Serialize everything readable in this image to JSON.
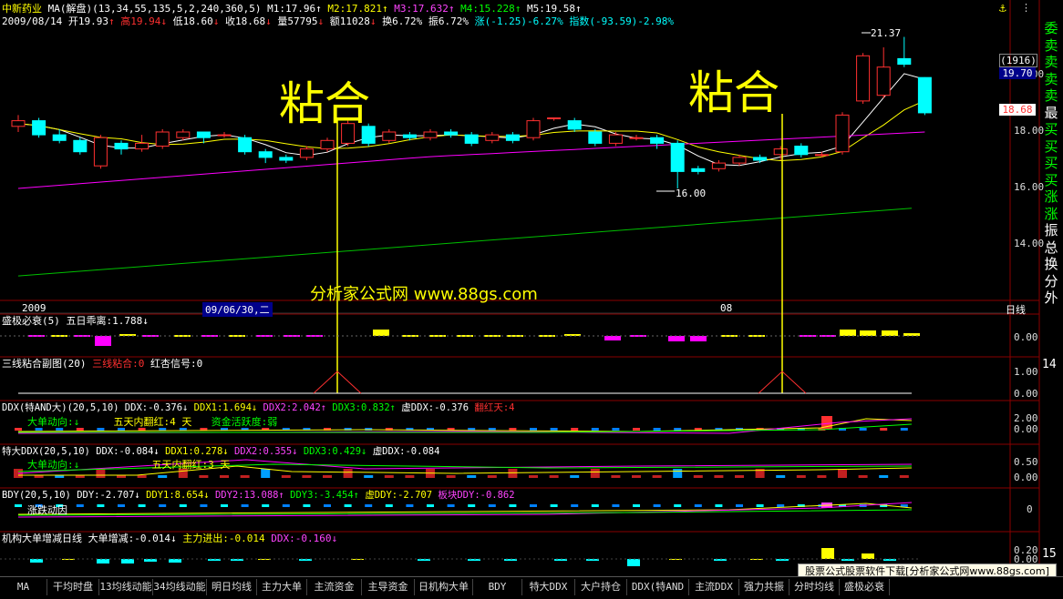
{
  "header": {
    "stock_name": "中新药业",
    "ma_label": "MA(解盘)(13,34,55,135,5,2,240,360,5)",
    "m1": "M1:17.96",
    "m2": "M2:17.821",
    "m3": "M3:17.632",
    "m4": "M4:15.228",
    "m5": "M5:19.58",
    "date": "2009/08/14",
    "open": "开19.93",
    "high": "高19.94",
    "low": "低18.60",
    "close": "收18.68",
    "volume": "量57795",
    "amount": "额11028",
    "turnover": "换6.72%",
    "amplitude": "振6.72%",
    "change": "涨(-1.25)-6.27%",
    "index": "指数(-93.59)-2.98%"
  },
  "main_chart": {
    "annotation_left": "粘合",
    "annotation_right": "粘合",
    "high_label": "21.37",
    "low_label": "16.00",
    "watermark": "分析家公式网 www.88gs.com",
    "date_axis": [
      "2009",
      "09/06/30,二",
      "08"
    ],
    "period_label": "日线",
    "price_ticks": [
      "20.00",
      "18.00",
      "16.00",
      "14.00"
    ],
    "box_count": "(1916)",
    "box_price": "19.70",
    "current_price": "18.68",
    "colors": {
      "up": "#ff3030",
      "down": "#00ffff",
      "ma_white": "#ffffff",
      "ma_yellow": "#ffff00",
      "ma_magenta": "#ff00ff",
      "ma_green": "#00c000"
    },
    "candles": [
      {
        "o": 18.2,
        "c": 18.4,
        "h": 18.6,
        "l": 18.0
      },
      {
        "o": 18.4,
        "c": 17.9,
        "h": 18.5,
        "l": 17.8
      },
      {
        "o": 17.9,
        "c": 17.7,
        "h": 18.1,
        "l": 17.6
      },
      {
        "o": 17.7,
        "c": 17.3,
        "h": 17.8,
        "l": 17.2
      },
      {
        "o": 16.8,
        "c": 17.8,
        "h": 17.9,
        "l": 16.7
      },
      {
        "o": 17.6,
        "c": 17.4,
        "h": 17.7,
        "l": 17.2
      },
      {
        "o": 17.4,
        "c": 17.6,
        "h": 17.9,
        "l": 17.3
      },
      {
        "o": 17.5,
        "c": 18.0,
        "h": 18.1,
        "l": 17.4
      },
      {
        "o": 17.8,
        "c": 18.0,
        "h": 18.1,
        "l": 17.7
      },
      {
        "o": 18.0,
        "c": 17.8,
        "h": 18.0,
        "l": 17.6
      },
      {
        "o": 17.9,
        "c": 17.9,
        "h": 18.0,
        "l": 17.8
      },
      {
        "o": 17.8,
        "c": 17.3,
        "h": 17.9,
        "l": 17.2
      },
      {
        "o": 17.3,
        "c": 17.1,
        "h": 17.4,
        "l": 16.9
      },
      {
        "o": 17.1,
        "c": 17.0,
        "h": 17.2,
        "l": 16.9
      },
      {
        "o": 17.1,
        "c": 17.4,
        "h": 17.5,
        "l": 17.0
      },
      {
        "o": 17.4,
        "c": 17.7,
        "h": 17.8,
        "l": 17.3
      },
      {
        "o": 17.6,
        "c": 18.3,
        "h": 18.4,
        "l": 17.5
      },
      {
        "o": 18.2,
        "c": 17.6,
        "h": 18.3,
        "l": 17.5
      },
      {
        "o": 17.7,
        "c": 18.0,
        "h": 18.1,
        "l": 17.6
      },
      {
        "o": 17.9,
        "c": 17.8,
        "h": 18.0,
        "l": 17.7
      },
      {
        "o": 17.8,
        "c": 18.0,
        "h": 18.1,
        "l": 17.7
      },
      {
        "o": 18.0,
        "c": 17.9,
        "h": 18.1,
        "l": 17.8
      },
      {
        "o": 17.9,
        "c": 17.6,
        "h": 18.0,
        "l": 17.5
      },
      {
        "o": 17.7,
        "c": 17.9,
        "h": 18.0,
        "l": 17.6
      },
      {
        "o": 17.9,
        "c": 17.7,
        "h": 18.0,
        "l": 17.6
      },
      {
        "o": 17.8,
        "c": 18.4,
        "h": 18.5,
        "l": 17.7
      },
      {
        "o": 18.5,
        "c": 18.5,
        "h": 18.5,
        "l": 18.4
      },
      {
        "o": 18.4,
        "c": 18.1,
        "h": 18.5,
        "l": 18.0
      },
      {
        "o": 18.0,
        "c": 17.6,
        "h": 18.1,
        "l": 17.5
      },
      {
        "o": 17.6,
        "c": 17.9,
        "h": 18.0,
        "l": 17.5
      },
      {
        "o": 17.8,
        "c": 17.8,
        "h": 17.9,
        "l": 17.7
      },
      {
        "o": 17.8,
        "c": 17.6,
        "h": 17.9,
        "l": 17.4
      },
      {
        "o": 17.6,
        "c": 16.6,
        "h": 17.7,
        "l": 16.0
      },
      {
        "o": 16.7,
        "c": 16.6,
        "h": 16.8,
        "l": 16.5
      },
      {
        "o": 16.7,
        "c": 16.9,
        "h": 17.0,
        "l": 16.6
      },
      {
        "o": 16.9,
        "c": 17.1,
        "h": 17.2,
        "l": 16.8
      },
      {
        "o": 17.1,
        "c": 17.0,
        "h": 17.2,
        "l": 16.9
      },
      {
        "o": 17.2,
        "c": 17.4,
        "h": 17.5,
        "l": 17.0
      },
      {
        "o": 17.5,
        "c": 17.2,
        "h": 17.6,
        "l": 17.1
      },
      {
        "o": 17.2,
        "c": 17.2,
        "h": 17.3,
        "l": 17.1
      },
      {
        "o": 17.3,
        "c": 18.6,
        "h": 18.7,
        "l": 17.2
      },
      {
        "o": 19.1,
        "c": 20.7,
        "h": 20.8,
        "l": 19.0
      },
      {
        "o": 19.3,
        "c": 20.3,
        "h": 21.0,
        "l": 19.2
      },
      {
        "o": 20.6,
        "c": 20.4,
        "h": 21.37,
        "l": 20.3
      },
      {
        "o": 19.93,
        "c": 18.68,
        "h": 19.94,
        "l": 18.6
      }
    ]
  },
  "panel_sjbs": {
    "title": "盛极必衰(5)",
    "value": "五日乖离:1.788↓",
    "tick": "0.00"
  },
  "panel_sxnh": {
    "title": "三线粘合副图(20)",
    "value1": "三线粘合:0",
    "value2": "红杏信号:0",
    "ticks": [
      "1.00",
      "0.00"
    ],
    "side_tick": "14"
  },
  "panel_ddx": {
    "title": "DDX(特AND大)(20,5,10)",
    "ddx": "DDX:-0.376↓",
    "ddx1": "DDX1:1.694↓",
    "ddx2": "DDX2:2.042↑",
    "ddx3": "DDX3:0.832↑",
    "xu": "虚DDX:-0.376",
    "fanhong": "翻红天:4",
    "line2_a": "大单动向:↓",
    "line2_b": "五天内翻红:4 天",
    "line2_c": "资金活跃度:弱",
    "ticks": [
      "2.00",
      "0.00"
    ]
  },
  "panel_tddx": {
    "title": "特大DDX(20,5,10)",
    "ddx": "DDX:-0.084↓",
    "ddx1": "DDX1:0.278↓",
    "ddx2": "DDX2:0.355↓",
    "ddx3": "DDX3:0.429↓",
    "xu": "虚DDX:-0.084",
    "line2_a": "大单动向:↓",
    "line2_b": "五天内翻红:3 天",
    "ticks": [
      "0.50",
      "0.00"
    ]
  },
  "panel_bdy": {
    "title": "BDY(20,5,10)",
    "ddy": "DDY:-2.707↓",
    "ddy1": "DDY1:8.654↓",
    "ddy2": "DDY2:13.088↑",
    "ddy3": "DDY3:-3.454↑",
    "xu": "虚DDY:-2.707",
    "block": "板块DDY:-0.862",
    "line2": "涨跌动因",
    "tick": "0"
  },
  "panel_jg": {
    "title": "机构大单增减日线",
    "v1": "大单增减:-0.014↓",
    "v2": "主力进出:-0.014",
    "v3": "DDX:-0.160↓",
    "ticks": [
      "0.20",
      "0.00"
    ],
    "side_tick": "15"
  },
  "side_buttons": [
    "委",
    "卖",
    "卖",
    "卖",
    "卖",
    "最",
    "买",
    "买",
    "买",
    "买",
    "涨",
    "涨",
    "振",
    "总",
    "换",
    "分",
    "外"
  ],
  "tabs": [
    "MA",
    "干均时盘",
    "13均线动能",
    "34均线动能",
    "明日均线",
    "主力大单",
    "主流资金",
    "主导资金",
    "日机构大单",
    "BDY",
    "特大DDX",
    "大户持仓",
    "DDX(特AND大)",
    "主流DDX",
    "强力共振",
    "分时均线",
    "盛极必衰"
  ],
  "banner": "股票公式股票软件下载[分析家公式网www.88gs.com]"
}
